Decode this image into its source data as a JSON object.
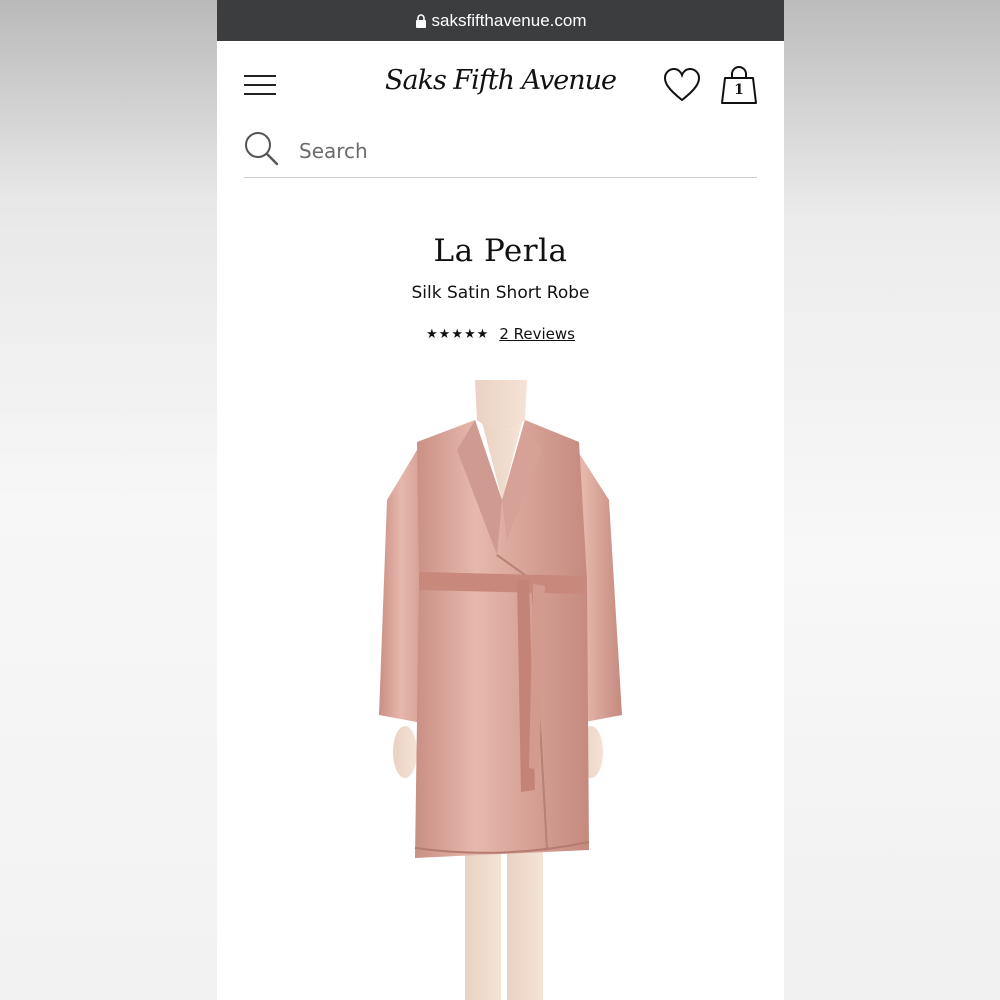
{
  "browser": {
    "url": "saksfifthavenue.com",
    "lock_icon": "lock-icon"
  },
  "header": {
    "menu_icon": "hamburger-menu-icon",
    "logo_text": "Saks Fifth Avenue",
    "wishlist_icon": "heart-icon",
    "bag_icon": "shopping-bag-icon",
    "bag_count": "1"
  },
  "search": {
    "placeholder": "Search",
    "icon": "search-icon"
  },
  "product": {
    "brand": "La Perla",
    "name": "Silk Satin Short Robe",
    "stars": "★★★★★",
    "rating": 5,
    "reviews_label": "2 Reviews",
    "image_color": "#d9a59a"
  }
}
